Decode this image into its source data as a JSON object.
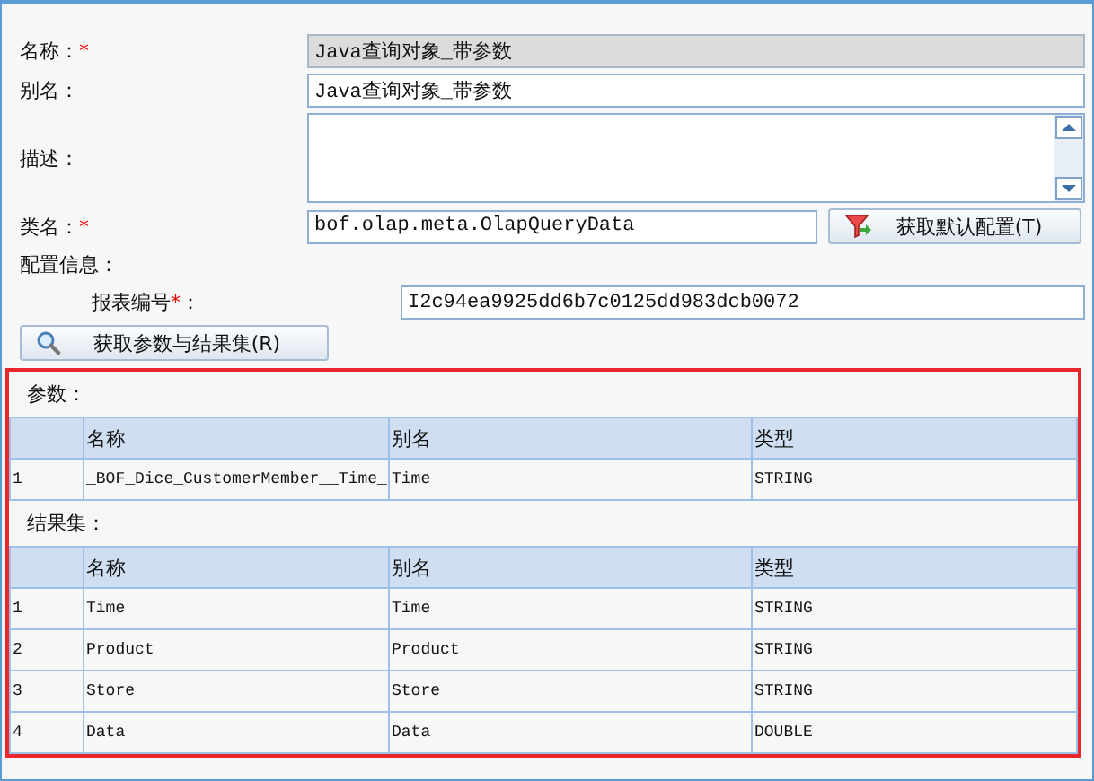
{
  "fields": [
    {
      "kind": "input",
      "label": "名称：",
      "required_mark": "*",
      "value": "Java查询对象_带参数",
      "disabled": true
    },
    {
      "kind": "input",
      "label": "别名：",
      "value": "Java查询对象_带参数",
      "disabled": false
    },
    {
      "kind": "textarea",
      "label": "描述："
    },
    {
      "kind": "input_button",
      "label": "类名：",
      "required_mark": "*",
      "value": "bof.olap.meta.OlapQueryData",
      "disabled": false,
      "button": "获取默认配置(T)"
    }
  ],
  "config": {
    "title": "配置信息：",
    "label": "报表编号",
    "required_mark": "*",
    "label_suffix": "：",
    "value": "I2c94ea9925dd6b7c0125dd983dcb0072",
    "button": "获取参数与结果集(R)"
  },
  "tables": [
    {
      "title": "参数：",
      "columns": [
        "名称",
        "别名",
        "类型"
      ],
      "rows": [
        {
          "index": "1",
          "cells": [
            "_BOF_Dice_CustomerMember__Time_",
            "Time",
            "STRING"
          ]
        }
      ]
    },
    {
      "title": "结果集：",
      "columns": [
        "名称",
        "别名",
        "类型"
      ],
      "rows": [
        {
          "index": "1",
          "cells": [
            "Time",
            "Time",
            "STRING"
          ]
        },
        {
          "index": "2",
          "cells": [
            "Product",
            "Product",
            "STRING"
          ]
        },
        {
          "index": "3",
          "cells": [
            "Store",
            "Store",
            "STRING"
          ]
        },
        {
          "index": "4",
          "cells": [
            "Data",
            "Data",
            "DOUBLE"
          ]
        }
      ]
    }
  ]
}
